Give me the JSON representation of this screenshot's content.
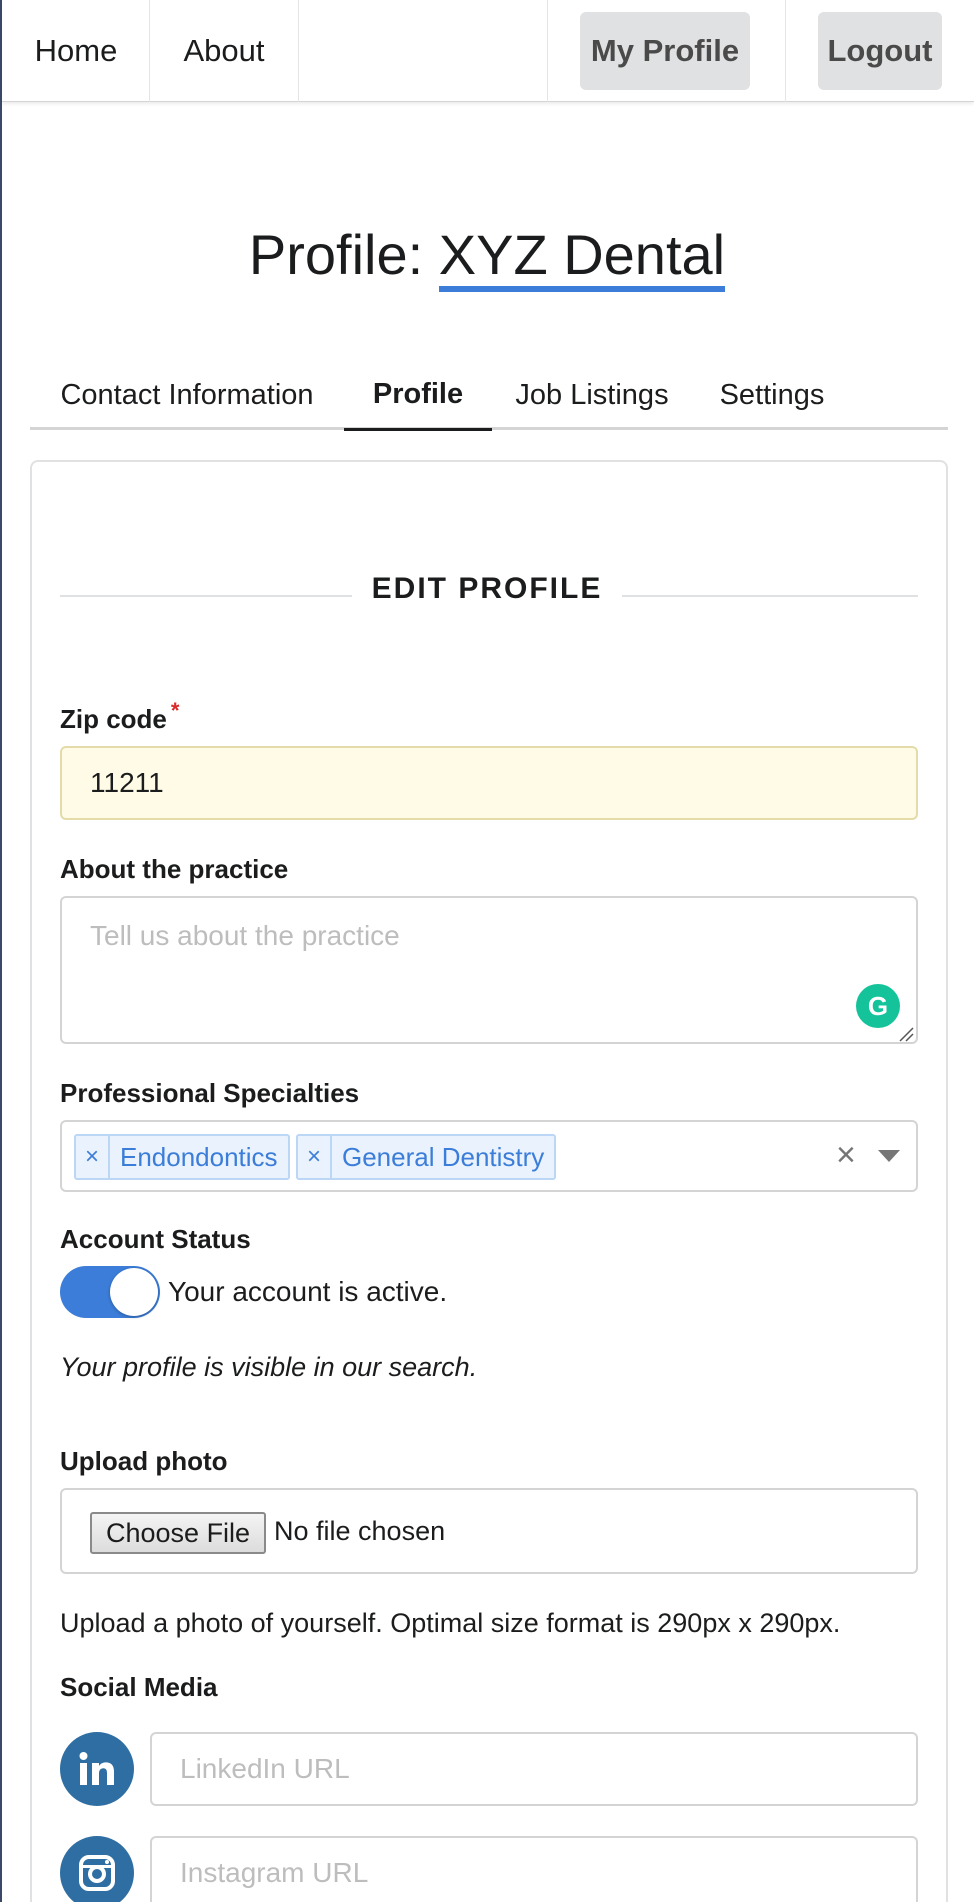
{
  "nav": {
    "home": "Home",
    "about": "About",
    "my_profile": "My Profile",
    "logout": "Logout"
  },
  "page": {
    "title_prefix": "Profile: ",
    "title_name": "XYZ Dental"
  },
  "tabs": [
    {
      "label": "Contact Information",
      "active": false
    },
    {
      "label": "Profile",
      "active": true
    },
    {
      "label": "Job Listings",
      "active": false
    },
    {
      "label": "Settings",
      "active": false
    }
  ],
  "form": {
    "section_title": "EDIT PROFILE",
    "zip": {
      "label": "Zip code",
      "required_mark": "*",
      "value": "11211"
    },
    "about": {
      "label": "About the practice",
      "placeholder": "Tell us about the practice"
    },
    "specialties": {
      "label": "Professional Specialties",
      "selected": [
        "Endondontics",
        "General Dentistry"
      ],
      "remove_glyph": "×",
      "clear_glyph": "×"
    },
    "account_status": {
      "label": "Account Status",
      "toggle_on": true,
      "toggle_text": "Your account is active.",
      "note": "Your profile is visible in our search."
    },
    "upload": {
      "label": "Upload photo",
      "button": "Choose File",
      "status": "No file chosen",
      "help": "Upload a photo of yourself. Optimal size format is 290px x 290px."
    },
    "social": {
      "label": "Social Media",
      "linkedin_placeholder": "LinkedIn URL",
      "instagram_placeholder": "Instagram URL"
    }
  },
  "colors": {
    "accent": "#3b7dd8",
    "zip_bg": "#fffbe6",
    "social_icon": "#2f6ea3",
    "grammarly": "#15c39a"
  },
  "icons": {
    "linkedin": "linkedin-icon",
    "instagram": "instagram-icon",
    "grammarly": "grammarly-icon"
  }
}
